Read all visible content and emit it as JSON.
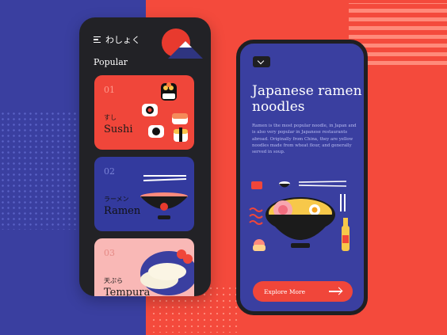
{
  "app": {
    "brand": "わしょく",
    "section_title": "Popular"
  },
  "cards": [
    {
      "num": "01",
      "jp": "すし",
      "en": "Sushi"
    },
    {
      "num": "02",
      "jp": "ラーメン",
      "en": "Ramen"
    },
    {
      "num": "03",
      "jp": "天ぷら",
      "en": "Tempura"
    }
  ],
  "detail": {
    "title": "Japanese ramen noodles",
    "description": "Ramen is the most popular noodle, in Japan and is also very popular in Japanese restaurants abroad. Originally from China, they are yellow noodles made from wheat flour, and generally served in soup.",
    "cta": "Explore More"
  },
  "icons": [
    "menu-icon",
    "mount-fuji-icon",
    "sushi-icon",
    "ramen-bowl-icon",
    "tempura-icon",
    "chevron-down-icon",
    "arrow-right-icon"
  ],
  "colors": {
    "blue": "#3a3fa0",
    "red": "#f44a3c",
    "dark": "#222226",
    "pink": "#f9b8b6"
  }
}
